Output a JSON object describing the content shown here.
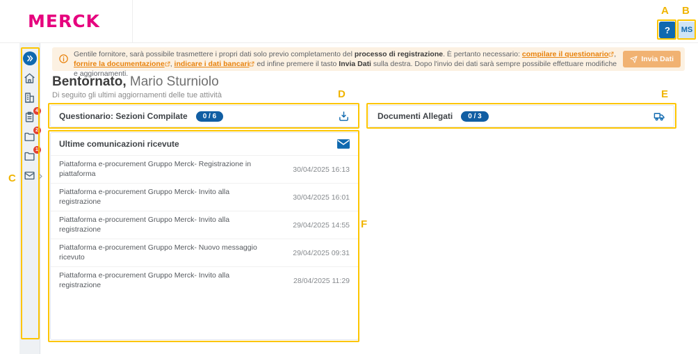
{
  "colors": {
    "brand_magenta": "#e6007e",
    "accent_blue": "#0f69af",
    "link_orange": "#e8820c",
    "badge_red": "#e34234",
    "annotation_yellow": "#fdc500"
  },
  "header": {
    "logo_text": "MERCK",
    "help_label": "?",
    "avatar_initials": "MS"
  },
  "sidebar": {
    "items": [
      {
        "name": "expand-sidebar",
        "icon": "chevrons-right-icon",
        "badge": null
      },
      {
        "name": "home",
        "icon": "home-icon",
        "badge": null
      },
      {
        "name": "company",
        "icon": "building-icon",
        "badge": null
      },
      {
        "name": "questionnaire",
        "icon": "clipboard-icon",
        "badge": "4"
      },
      {
        "name": "folder-a",
        "icon": "folder-icon",
        "badge": "2"
      },
      {
        "name": "folder-b",
        "icon": "folder-icon",
        "badge": "1"
      },
      {
        "name": "messages",
        "icon": "mail-icon",
        "badge": null
      }
    ]
  },
  "banner": {
    "s1": "Gentile fornitore, sarà possibile trasmettere i propri dati solo previo completamento del ",
    "bold1": "processo di registrazione",
    "s2": ". È pertanto necessario: ",
    "link1": "compilare il questionario",
    "sep1": ", ",
    "link2": "fornire la documentazione",
    "sep2": ", ",
    "link3": "indicare i dati bancari",
    "s3": " ed infine premere il tasto ",
    "bold2": "Invia Dati",
    "s4": " sulla destra. Dopo l'invio dei dati sarà sempre possibile effettuare modifiche e aggiornamenti.",
    "button_label": "Invia Dati"
  },
  "welcome": {
    "greeting": "Bentornato,",
    "name": " Mario Sturniolo",
    "subtitle": "Di seguito gli ultimi aggiornamenti delle tue attività"
  },
  "cards": {
    "questionario": {
      "title": "Questionario: Sezioni Compilate",
      "badge": "0 / 6"
    },
    "documenti": {
      "title": "Documenti Allegati",
      "badge": "0 / 3"
    }
  },
  "communications": {
    "title": "Ultime comunicazioni ricevute",
    "items": [
      {
        "title": "Piattaforma e-procurement Gruppo Merck- Registrazione in piattaforma",
        "date": "30/04/2025 16:13"
      },
      {
        "title": "Piattaforma e-procurement Gruppo Merck- Invito alla registrazione",
        "date": "30/04/2025 16:01"
      },
      {
        "title": "Piattaforma e-procurement Gruppo Merck- Invito alla registrazione",
        "date": "29/04/2025 14:55"
      },
      {
        "title": "Piattaforma e-procurement Gruppo Merck- Nuovo messaggio ricevuto",
        "date": "29/04/2025 09:31"
      },
      {
        "title": "Piattaforma e-procurement Gruppo Merck- Invito alla registrazione",
        "date": "28/04/2025 11:29"
      }
    ]
  },
  "annotations": {
    "a": "A",
    "b": "B",
    "c": "C",
    "d": "D",
    "e": "E",
    "f": "F"
  }
}
